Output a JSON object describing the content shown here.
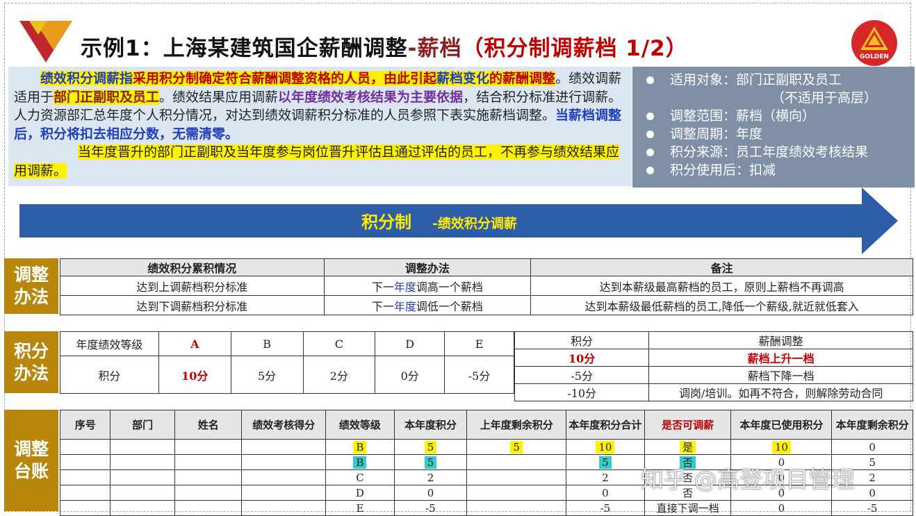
{
  "title": {
    "part1": "示例1：上海某建筑国企薪酬调整",
    "part2": "-薪档",
    "part3": "（积分制调薪档 1/2）"
  },
  "logo_text": "GOLDEN",
  "intro": {
    "p1_a": "绩效积分调薪指",
    "p1_b": "采用积分制确定符合薪酬调整资格的人员，由此引起",
    "p1_c": "薪档变化",
    "p1_d": "的薪酬调整",
    "p1_e": "。绩效调薪适用于",
    "p1_f": "部门正副职及员工",
    "p1_g": "。绩效结果应用调薪",
    "p1_h": "以年度绩效考核结果为主要依据",
    "p1_i": "，结合积分标准进行调薪。人力资源部汇总年度个人积分情况，对达到绩效调薪积分标准的人员参照下表实施薪档调整。",
    "p1_j": "当薪档调整后，积分将扣去相应分数，无需清零。",
    "p2": "当年度晋升的部门正副职及当年度参与岗位晋升评估且通过评估的员工，不再参与绩效结果应用调薪。"
  },
  "info": {
    "items": [
      "适用对象：部门正副职及员工",
      "调整范围：薪档（横向）",
      "调整周期：年度",
      "积分来源：员工年度绩效考核结果",
      "积分使用后：扣减"
    ],
    "note": "（不适用于高层）"
  },
  "arrow": {
    "main": "积分制",
    "sub": "-绩效积分调薪"
  },
  "section1": {
    "label_l1": "调整",
    "label_l2": "办法",
    "headers": [
      "绩效积分累积情况",
      "调整办法",
      "备注"
    ],
    "rows": [
      {
        "a": "达到上调薪档积分标准",
        "b1": "下一",
        "b2": "年度",
        "b3": "调高一个薪档",
        "c": "达到本薪级最高薪档的员工，原则上薪档不再调高"
      },
      {
        "a": "达到下调薪档积分标准",
        "b1": "下一",
        "b2": "年度",
        "b3": "调低一个薪档",
        "c": "达到本薪级最低薪档的员工,降低一个薪级,就近就低套入"
      }
    ]
  },
  "section2": {
    "label_l1": "积分",
    "label_l2": "办法",
    "grade_label": "年度绩效等级",
    "score_label": "积分",
    "grades": [
      "A",
      "B",
      "C",
      "D",
      "E"
    ],
    "scores": [
      "10分",
      "5分",
      "2分",
      "0分",
      "-5分"
    ],
    "right_headers": [
      "积分",
      "薪酬调整"
    ],
    "right_rows": [
      {
        "score": "10分",
        "adj": "薪档上升一档"
      },
      {
        "score": "-5分",
        "adj": "薪档下降一档"
      },
      {
        "score": "-10分",
        "adj": "调岗/培训。如再不符合，则解除劳动合同"
      }
    ]
  },
  "section3": {
    "label_l1": "调整",
    "label_l2": "台账",
    "headers": [
      "序号",
      "部门",
      "姓名",
      "绩效考核得分",
      "绩效等级",
      "本年度积分",
      "上年度剩余积分",
      "本年度积分合计",
      "是否可调薪",
      "本年度已使用积分",
      "本年度剩余积分"
    ],
    "rows": [
      {
        "grade": "B",
        "score": "5",
        "prev": "5",
        "total": "10",
        "can": "是",
        "used": "10",
        "remain": "0"
      },
      {
        "grade": "B",
        "score": "5",
        "prev": "",
        "total": "5",
        "can": "否",
        "used": "0",
        "remain": "5"
      },
      {
        "grade": "C",
        "score": "2",
        "prev": "",
        "total": "2",
        "can": "否",
        "used": "0",
        "remain": "2"
      },
      {
        "grade": "D",
        "score": "0",
        "prev": "",
        "total": "0",
        "can": "否",
        "used": "0",
        "remain": "0"
      },
      {
        "grade": "E",
        "score": "-5",
        "prev": "",
        "total": "-5",
        "can": "直接下调一档",
        "used": "0",
        "remain": "-5"
      }
    ]
  },
  "watermark": "知乎 @高登项目管理",
  "colors": {
    "accent_gold": "#B8860B",
    "arrow_blue": "#2E5DA8",
    "info_gray": "#7F8FA6",
    "intro_bg": "#DCE6F2",
    "highlight_yellow": "#FFF200",
    "highlight_cyan": "#33CCCC",
    "title_red": "#C00000"
  }
}
